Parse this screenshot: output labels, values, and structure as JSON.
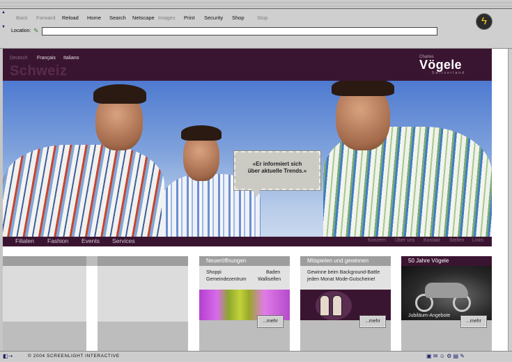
{
  "browser": {
    "toolbar": [
      "Back",
      "Forward",
      "Reload",
      "Home",
      "Search",
      "Netscape",
      "Images",
      "Print",
      "Security",
      "Shop",
      "Stop"
    ],
    "location_label": "Location:",
    "location_value": "",
    "status_text": "© 2004 SCREENLIGHT INTERACTIVE"
  },
  "site": {
    "languages": [
      "Deutsch",
      "Français",
      "Italiano"
    ],
    "country": "Schweiz",
    "brand_small": "Charles",
    "brand_name": "Vögele",
    "brand_tag": "Switzerland",
    "bubble_lines": [
      "«Er informiert sich",
      "über aktuelle Trends.»"
    ],
    "nav_main": [
      "Filialen",
      "Fashion",
      "Events",
      "Services"
    ],
    "nav_sub": [
      "Konzern",
      "Über uns",
      "Kontakt",
      "Stellen",
      "Links"
    ],
    "teasers": {
      "neueroeffnungen": {
        "title": "Neueröffnungen",
        "row1_left": "Shoppi",
        "row1_right": "Baden",
        "row2_left": "Gemeindezentrum",
        "row2_right": "Wallisellen",
        "mehr": "...mehr"
      },
      "mitspielen": {
        "title": "Mitspielen und gewinnen",
        "line1": "Gewinne beim Background-Battle",
        "line2": "jeden Monat Mode-Gutscheine!",
        "mehr": "...mehr"
      },
      "jubilaeum": {
        "title": "50 Jahre Vögele",
        "caption": "Jubiläum-Angebote",
        "mehr": "...mehr"
      }
    }
  }
}
